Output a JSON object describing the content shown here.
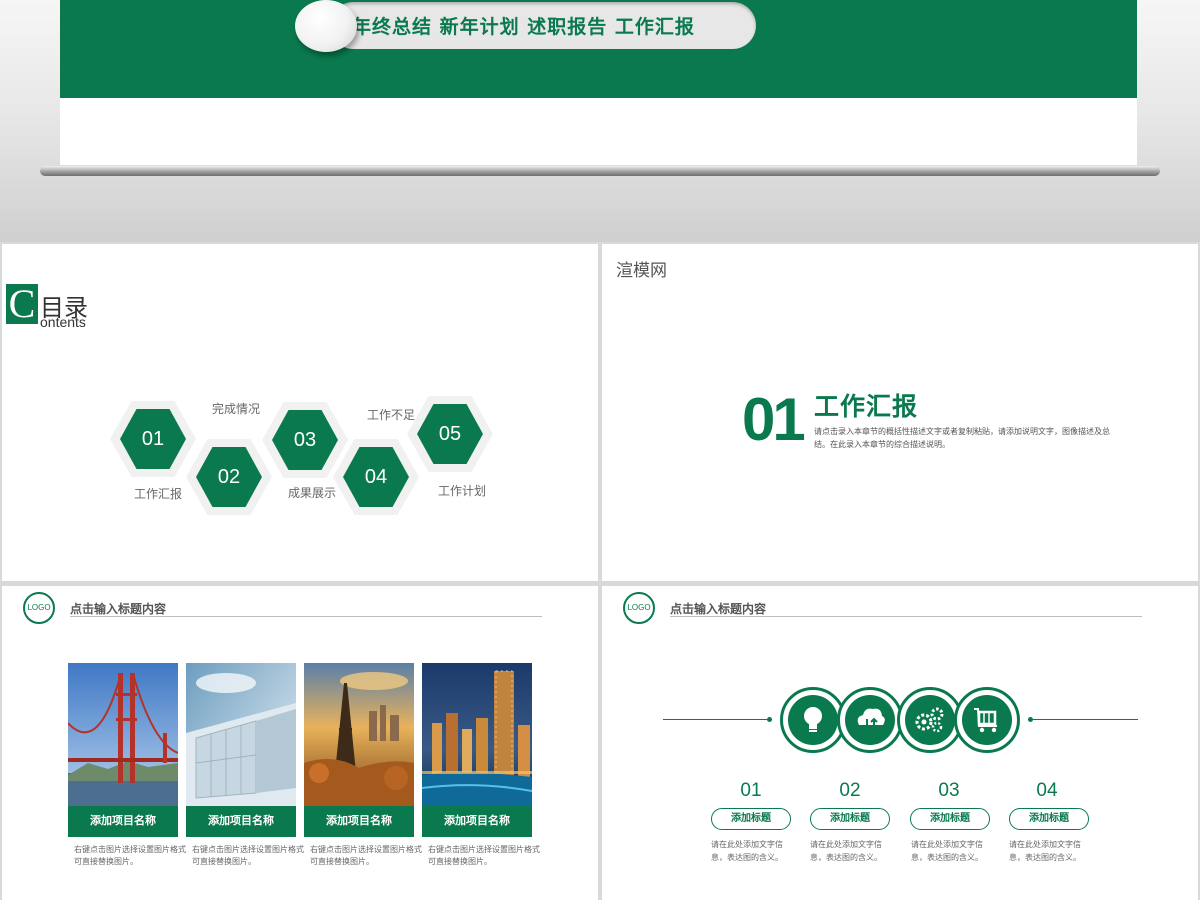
{
  "banner": {
    "tagline": "年终总结  新年计划  述职报告  工作汇报"
  },
  "contents": {
    "letter": "C",
    "title": "目录",
    "subtitle": "ontents",
    "items": [
      {
        "num": "01",
        "label": "工作汇报"
      },
      {
        "num": "02",
        "label": "完成情况"
      },
      {
        "num": "03",
        "label": "成果展示"
      },
      {
        "num": "04",
        "label": "工作不足"
      },
      {
        "num": "05",
        "label": "工作计划"
      }
    ]
  },
  "section": {
    "brand": "渲模网",
    "number": "01",
    "title": "工作汇报",
    "description": "请点击录入本章节的概括性描述文字或者复制粘贴，请添加说明文字，图像描述及总结。在此录入本章节的综合描述说明。"
  },
  "projects": {
    "logo": "LOGO",
    "header": "点击输入标题内容",
    "cards": [
      {
        "image": "golden-gate-bridge-photo",
        "label": "添加项目名称",
        "desc": "右键点击图片选择设置图片格式可直接替换图片。"
      },
      {
        "image": "glass-building-photo",
        "label": "添加项目名称",
        "desc": "右键点击图片选择设置图片格式可直接替换图片。"
      },
      {
        "image": "eiffel-tower-photo",
        "label": "添加项目名称",
        "desc": "右键点击图片选择设置图片格式可直接替换图片。"
      },
      {
        "image": "city-night-photo",
        "label": "添加项目名称",
        "desc": "右键点击图片选择设置图片格式可直接替换图片。"
      }
    ]
  },
  "features": {
    "logo": "LOGO",
    "header": "点击输入标题内容",
    "items": [
      {
        "icon": "lightbulb-icon",
        "num": "01",
        "button": "添加标题",
        "desc": "请在此处添加文字信息，表达图的含义。"
      },
      {
        "icon": "cloud-sync-icon",
        "num": "02",
        "button": "添加标题",
        "desc": "请在此处添加文字信息，表达图的含义。"
      },
      {
        "icon": "gears-icon",
        "num": "03",
        "button": "添加标题",
        "desc": "请在此处添加文字信息，表达图的含义。"
      },
      {
        "icon": "cart-icon",
        "num": "04",
        "button": "添加标题",
        "desc": "请在此处添加文字信息，表达图的含义。"
      }
    ]
  },
  "colors": {
    "brand_green": "#0a7a4e",
    "panel_bg": "#ffffff",
    "frame_bg": "#d9d9d9"
  }
}
